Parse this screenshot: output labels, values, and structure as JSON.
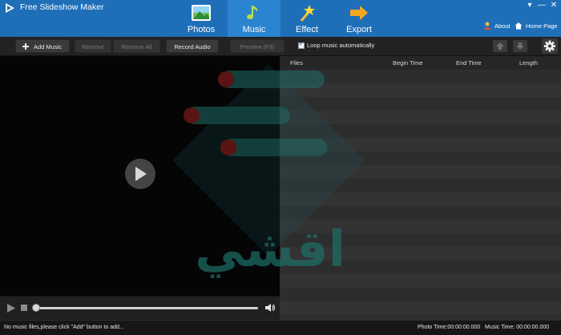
{
  "app": {
    "title": "Free Slideshow Maker"
  },
  "nav": {
    "tabs": [
      {
        "label": "Photos",
        "icon": "photos-icon"
      },
      {
        "label": "Music",
        "icon": "music-note-icon"
      },
      {
        "label": "Effect",
        "icon": "magic-wand-icon"
      },
      {
        "label": "Export",
        "icon": "export-arrow-icon"
      }
    ],
    "active": "Music"
  },
  "top_links": {
    "about": "About",
    "home_page": "Home Page"
  },
  "toolbar": {
    "add_music": "Add Music",
    "remove": "Remove",
    "remove_all": "Remove All",
    "record_audio": "Record Audio",
    "preview": "Preview (F9)",
    "loop_label": "Loop music automatically",
    "loop_checked": true
  },
  "table": {
    "headers": {
      "files": "Files",
      "begin_time": "Begin Time",
      "end_time": "End Time",
      "length": "Length"
    },
    "rows": []
  },
  "status": {
    "message": "No music files,please click \"Add\" button to add...",
    "photo_time": "Photo Time:00:00:00.000",
    "music_time": "Music Time:  00:00:00.000"
  },
  "player": {
    "progress": 0
  },
  "watermark": {
    "text": "اقشي"
  },
  "colors": {
    "brand_blue": "#1e6fb8",
    "active_tab": "#2b84cf",
    "watermark_teal": "#1e7068",
    "watermark_red": "#a0211f"
  }
}
